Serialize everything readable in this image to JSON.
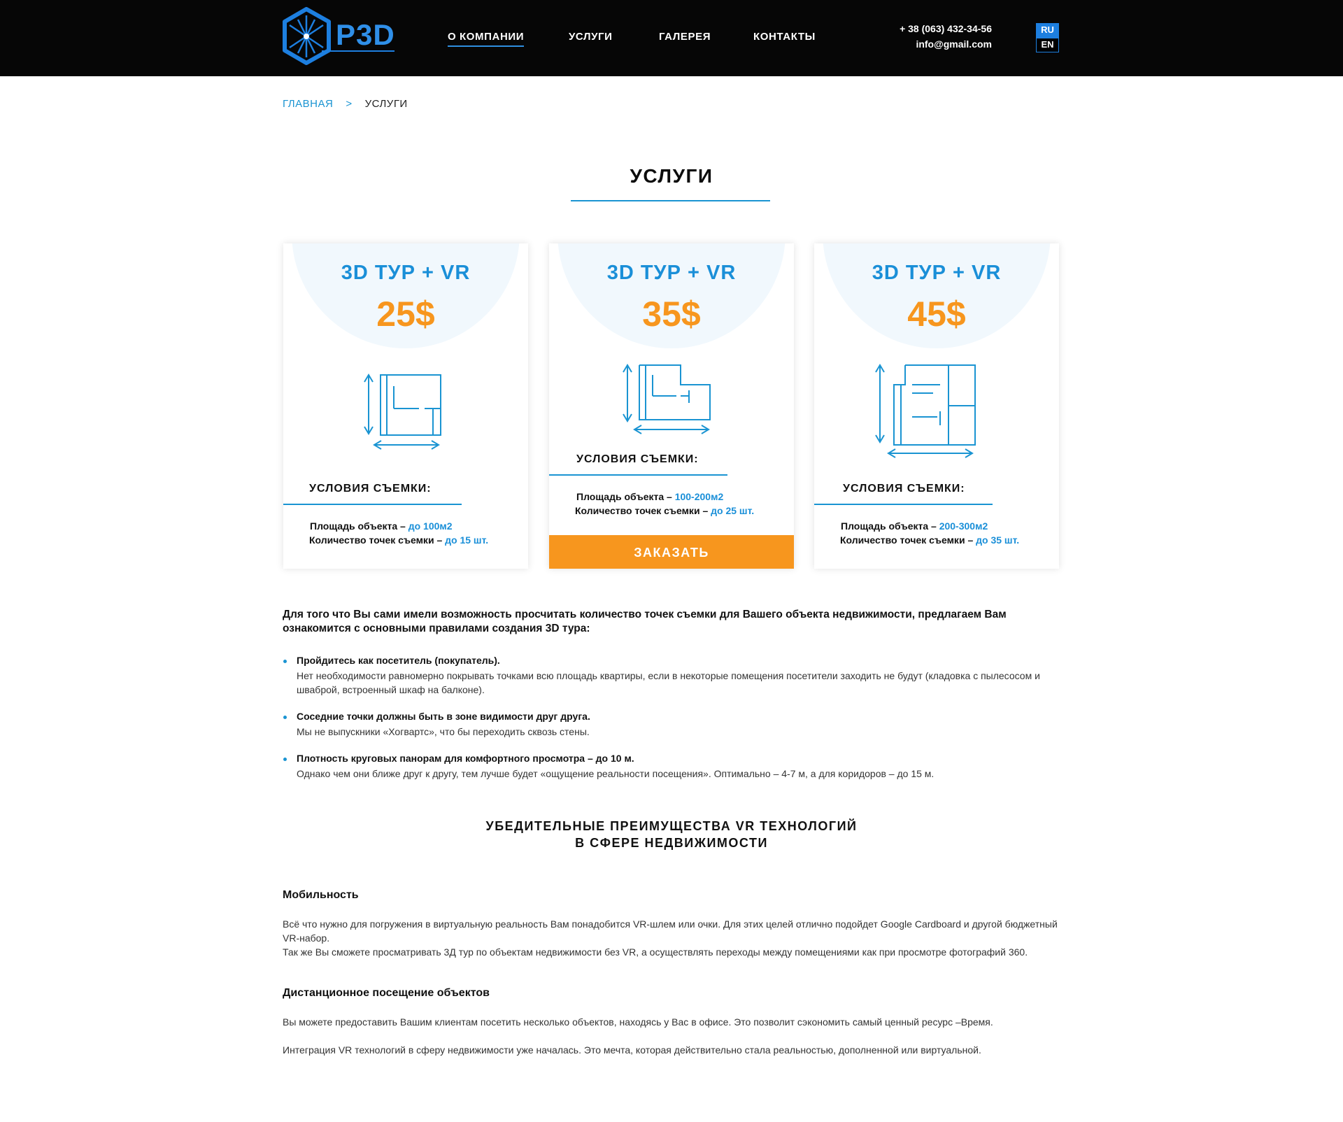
{
  "header": {
    "logo_text": "P3D",
    "nav": [
      {
        "label": "О КОМПАНИИ"
      },
      {
        "label": "УСЛУГИ"
      },
      {
        "label": "ГАЛЕРЕЯ"
      },
      {
        "label": "КОНТАКТЫ"
      }
    ],
    "phone": "+ 38 (063) 432-34-56",
    "email": "info@gmail.com",
    "lang_ru": "RU",
    "lang_en": "EN"
  },
  "breadcrumb": {
    "home": "ГЛАВНАЯ",
    "separator": ">",
    "current": "УСЛУГИ"
  },
  "page_title": "УСЛУГИ",
  "cards": [
    {
      "title": "3D ТУР + VR",
      "price": "25$",
      "conditions_title": "УСЛОВИЯ СЪЕМКИ:",
      "area_label": "Площадь объекта –",
      "area_value": "до 100м2",
      "points_label": "Количество точек съемки –",
      "points_value": "до 15 шт."
    },
    {
      "title": "3D ТУР + VR",
      "price": "35$",
      "conditions_title": "УСЛОВИЯ СЪЕМКИ:",
      "area_label": "Площадь объекта –",
      "area_value": "100-200м2",
      "points_label": "Количество точек съемки –",
      "points_value": "до 25 шт.",
      "button": "ЗАКАЗАТЬ"
    },
    {
      "title": "3D ТУР + VR",
      "price": "45$",
      "conditions_title": "УСЛОВИЯ СЪЕМКИ:",
      "area_label": "Площадь объекта –",
      "area_value": "200-300м2",
      "points_label": "Количество точек съемки –",
      "points_value": "до 35 шт."
    }
  ],
  "intro": "Для того что Вы сами имели возможность просчитать количество точек съемки для Вашего объекта недвижимости, предлагаем Вам ознакомится с основными правилами создания 3D тура:",
  "rules": [
    {
      "title": "Пройдитесь как посетитель (покупатель).",
      "text": "Нет необходимости равномерно покрывать точками всю площадь квартиры, если в некоторые помещения посетители заходить не будут (кладовка с пылесосом и шваброй, встроенный шкаф на балконе)."
    },
    {
      "title": "Соседние точки должны быть в зоне видимости друг друга.",
      "text": "Мы не выпускники «Хогвартс», что бы переходить сквозь стены."
    },
    {
      "title": "Плотность круговых панорам для комфортного просмотра – до 10 м.",
      "text": "Однако чем они ближе друг к другу, тем лучше будет «ощущение реальности посещения». Оптимально – 4-7 м, а для коридоров – до 15 м."
    }
  ],
  "advantages": {
    "title_line1": "УБЕДИТЕЛЬНЫЕ ПРЕИМУЩЕСТВА VR ТЕХНОЛОГИЙ",
    "title_line2": "В СФЕРЕ НЕДВИЖИМОСТИ",
    "sections": [
      {
        "heading": "Мобильность",
        "p1": "Всё что нужно для погружения в виртуальную реальность Вам понадобится VR-шлем или очки. Для этих целей отлично подойдет Google Cardboard и другой бюджетный VR-набор.",
        "p2": "Так же Вы сможете просматривать 3Д тур по объектам недвижимости без VR, а осуществлять переходы между помещениями как при просмотре фотографий 360."
      },
      {
        "heading": "Дистанционное посещение объектов",
        "p1": "Вы можете предоставить Вашим клиентам посетить несколько объектов, находясь у Вас в офисе. Это позволит сэкономить самый ценный ресурс –Время.",
        "p2": "Интеграция VR технологий в сферу недвижимости уже началась. Это мечта, которая действительно стала реальностью, дополненной или виртуальной."
      }
    ]
  },
  "colors": {
    "header_bg": "#060606",
    "accent_blue": "#1a8fd8",
    "accent_orange": "#f7961e"
  }
}
